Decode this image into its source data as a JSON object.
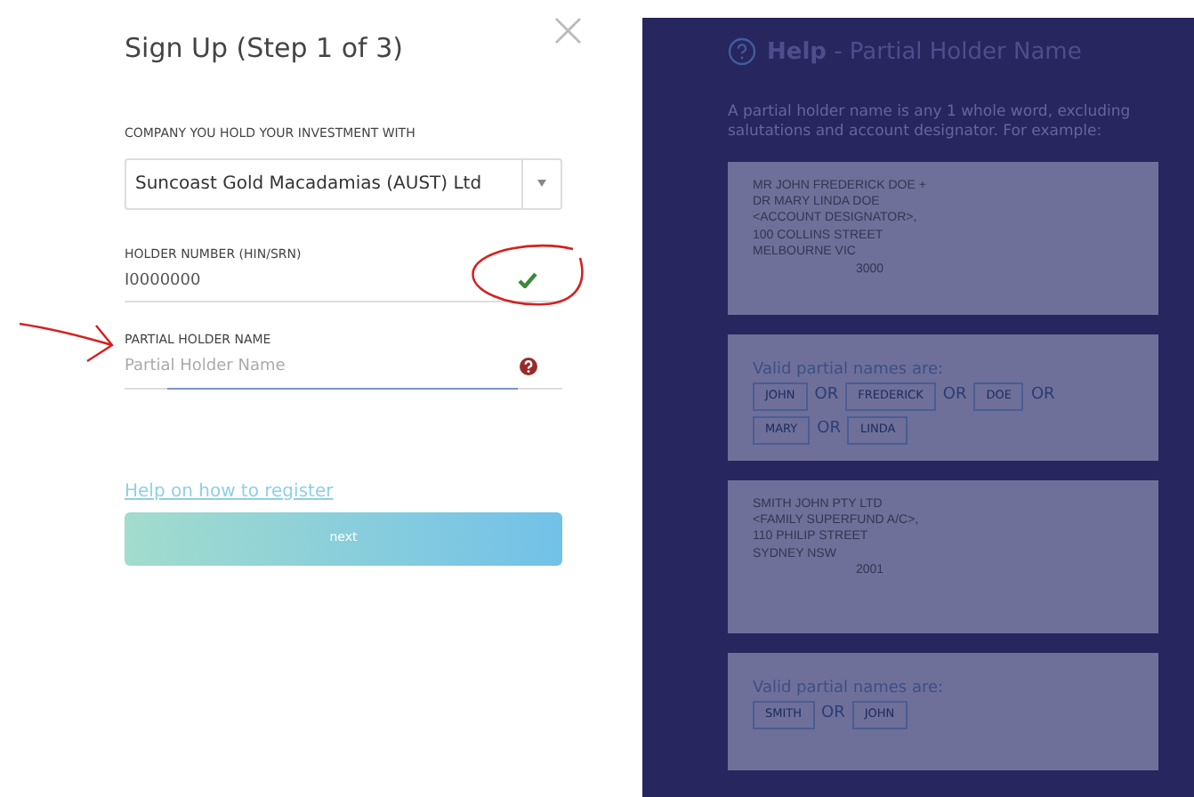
{
  "form": {
    "title": "Sign Up (Step 1 of 3)",
    "close": "×",
    "company": {
      "label": "COMPANY YOU HOLD YOUR INVESTMENT WITH",
      "value": "Suncoast Gold Macadamias (AUST) Ltd"
    },
    "holder_number": {
      "label": "HOLDER NUMBER (HIN/SRN)",
      "value": "I0000000",
      "valid": true
    },
    "partial_name": {
      "label": "PARTIAL HOLDER NAME",
      "placeholder": "Partial Holder Name",
      "focused": true
    },
    "help_link": "Help on how to register",
    "next_button": "next"
  },
  "help": {
    "title": "**Help** - Partial Holder Name",
    "intro": "A partial holder name is any 1 whole word, excluding salutations and account designator. For example:",
    "examples": [
      {
        "kind": "address",
        "lines": [
          "MR JOHN FREDERICK DOE +",
          "DR MARY LINDA DOE",
          "<ACCOUNT DESIGNATOR>,",
          "100 COLLINS STREET",
          "MELBOURNE VIC"
        ],
        "postcode": "3000"
      },
      {
        "kind": "names",
        "label": "Valid partial names are:",
        "tokens": [
          {
            "kind": "name",
            "text": "JOHN"
          },
          {
            "kind": "or",
            "text": "OR"
          },
          {
            "kind": "name",
            "text": "FREDERICK"
          },
          {
            "kind": "or",
            "text": "OR"
          },
          {
            "kind": "name",
            "text": "DOE"
          },
          {
            "kind": "or",
            "text": "OR"
          },
          {
            "kind": "name",
            "text": "MARY"
          },
          {
            "kind": "or",
            "text": "OR"
          },
          {
            "kind": "name",
            "text": "LINDA"
          }
        ]
      },
      {
        "kind": "address",
        "lines": [
          "SMITH JOHN PTY LTD",
          "<FAMILY SUPERFUND A/C>,",
          "110 PHILIP STREET",
          "SYDNEY NSW"
        ],
        "postcode": "2001"
      },
      {
        "kind": "names",
        "label": "Valid partial names are:",
        "tokens": [
          {
            "kind": "name",
            "text": "SMITH"
          },
          {
            "kind": "or",
            "text": "OR"
          },
          {
            "kind": "name",
            "text": "JOHN"
          }
        ]
      }
    ]
  }
}
